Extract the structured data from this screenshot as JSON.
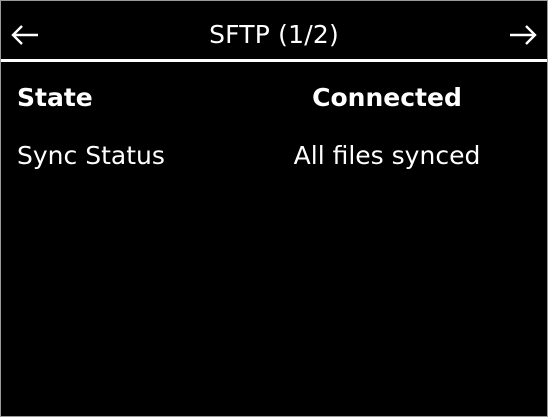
{
  "header": {
    "title": "SFTP (1/2)",
    "prev_icon": "arrow-left-icon",
    "next_icon": "arrow-right-icon"
  },
  "rows": [
    {
      "label": "State",
      "value": "Connected"
    },
    {
      "label": "Sync Status",
      "value": "All files synced"
    }
  ],
  "colors": {
    "background": "#000000",
    "text": "#ffffff",
    "divider": "#ffffff"
  }
}
